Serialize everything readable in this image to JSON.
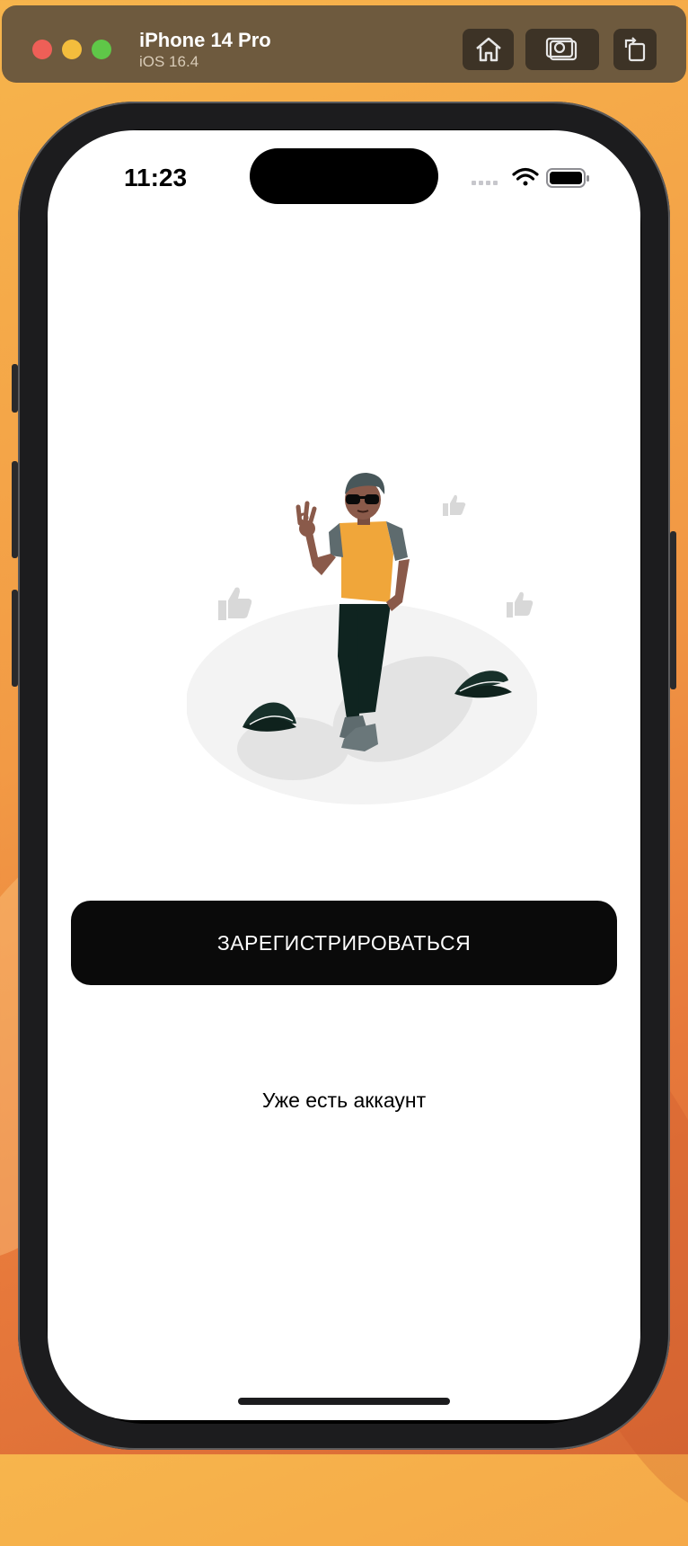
{
  "simulator": {
    "device_name": "iPhone 14 Pro",
    "os_version": "iOS 16.4",
    "buttons": {
      "home": "home-icon",
      "screenshot": "camera-icon",
      "rotate": "rotate-icon"
    }
  },
  "status_bar": {
    "time": "11:23",
    "icons": [
      "cellular-signal-icon",
      "wifi-icon",
      "battery-icon"
    ]
  },
  "screen": {
    "illustration": "person-ok-gesture-illustration",
    "primary_button_label": "ЗАРЕГИСТРИРОВАТЬСЯ",
    "secondary_link_label": "Уже есть аккаунт"
  },
  "colors": {
    "primary_button_bg": "#0a0a0a",
    "accent_shirt": "#f0a63a",
    "plant_dark": "#17302a"
  }
}
